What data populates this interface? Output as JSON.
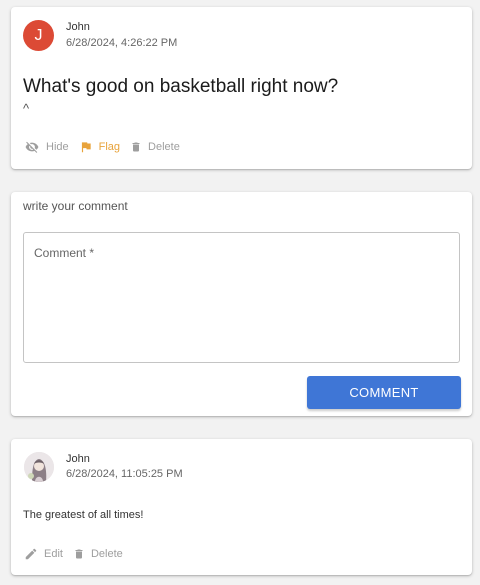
{
  "post": {
    "avatar_initial": "J",
    "author": "John",
    "date": "6/28/2024, 4:26:22 PM",
    "title": "What's good on basketball right now?",
    "caret": "^",
    "actions": {
      "hide": "Hide",
      "flag": "Flag",
      "delete": "Delete"
    }
  },
  "comment_form": {
    "label": "write your comment",
    "placeholder": "Comment *",
    "value": "",
    "submit": "COMMENT"
  },
  "reply": {
    "author": "John",
    "date": "6/28/2024, 11:05:25 PM",
    "text": "The greatest of all times!",
    "actions": {
      "edit": "Edit",
      "delete": "Delete"
    }
  },
  "colors": {
    "avatar": "#dc4a35",
    "flag": "#e8a33b",
    "button": "#3f76d6",
    "muted": "#9e9e9e"
  },
  "icons": {
    "hide": "eye-off-icon",
    "flag": "flag-icon",
    "delete": "trash-icon",
    "edit": "pencil-icon"
  }
}
